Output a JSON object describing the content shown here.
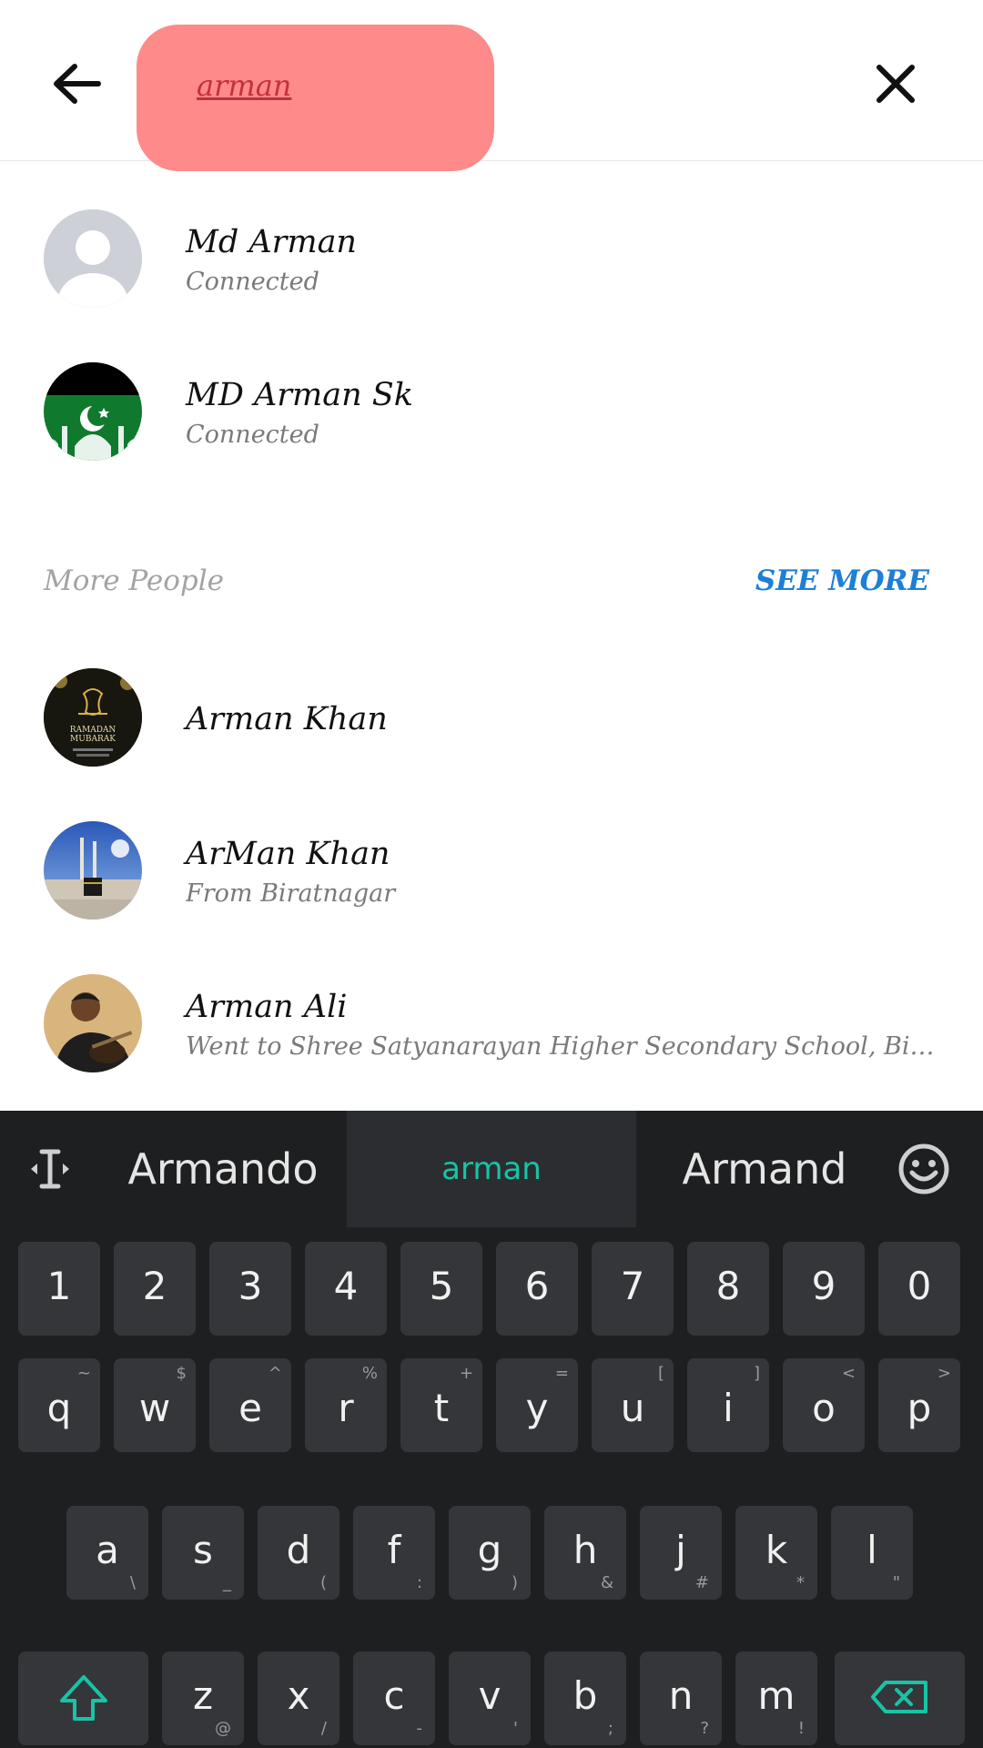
{
  "search": {
    "query": "arman"
  },
  "connected": [
    {
      "name": "Md Arman",
      "subtitle": "Connected"
    },
    {
      "name": "MD Arman Sk",
      "subtitle": "Connected"
    }
  ],
  "more_people": {
    "title": "More People",
    "see_more": "SEE MORE",
    "people": [
      {
        "name": "Arman Khan",
        "subtitle": ""
      },
      {
        "name": "ArMan Khan",
        "subtitle": "From Biratnagar"
      },
      {
        "name": "Arman Ali",
        "subtitle": "Went to Shree Satyanarayan Higher Secondary School, Biratnag..."
      }
    ]
  },
  "avatar_art": {
    "ramadan_line1": "RAMADAN",
    "ramadan_line2": "MUBARAK"
  },
  "keyboard": {
    "suggestions": [
      "Armando",
      "arman",
      "Armand"
    ],
    "numbers": [
      "1",
      "2",
      "3",
      "4",
      "5",
      "6",
      "7",
      "8",
      "9",
      "0"
    ],
    "row1": [
      "q",
      "w",
      "e",
      "r",
      "t",
      "y",
      "u",
      "i",
      "o",
      "p"
    ],
    "row1_alt": [
      "~",
      "$",
      "^",
      "%",
      "+",
      "=",
      "[",
      "]",
      "<",
      ">"
    ],
    "row2": [
      "a",
      "s",
      "d",
      "f",
      "g",
      "h",
      "j",
      "k",
      "l"
    ],
    "row2_alt": [
      "\\",
      "_",
      "(",
      ":",
      ")",
      "&",
      "#",
      "*",
      "\""
    ],
    "row3": [
      "z",
      "x",
      "c",
      "v",
      "b",
      "n",
      "m"
    ],
    "row3_alt": [
      "@",
      "/",
      "-",
      "'",
      ";",
      "?",
      "!"
    ],
    "accent_color": "#19c3a6"
  },
  "colors": {
    "search_highlight": "#ff8a8a",
    "link": "#1d7fd6",
    "keyboard_bg": "#1e1f20"
  }
}
